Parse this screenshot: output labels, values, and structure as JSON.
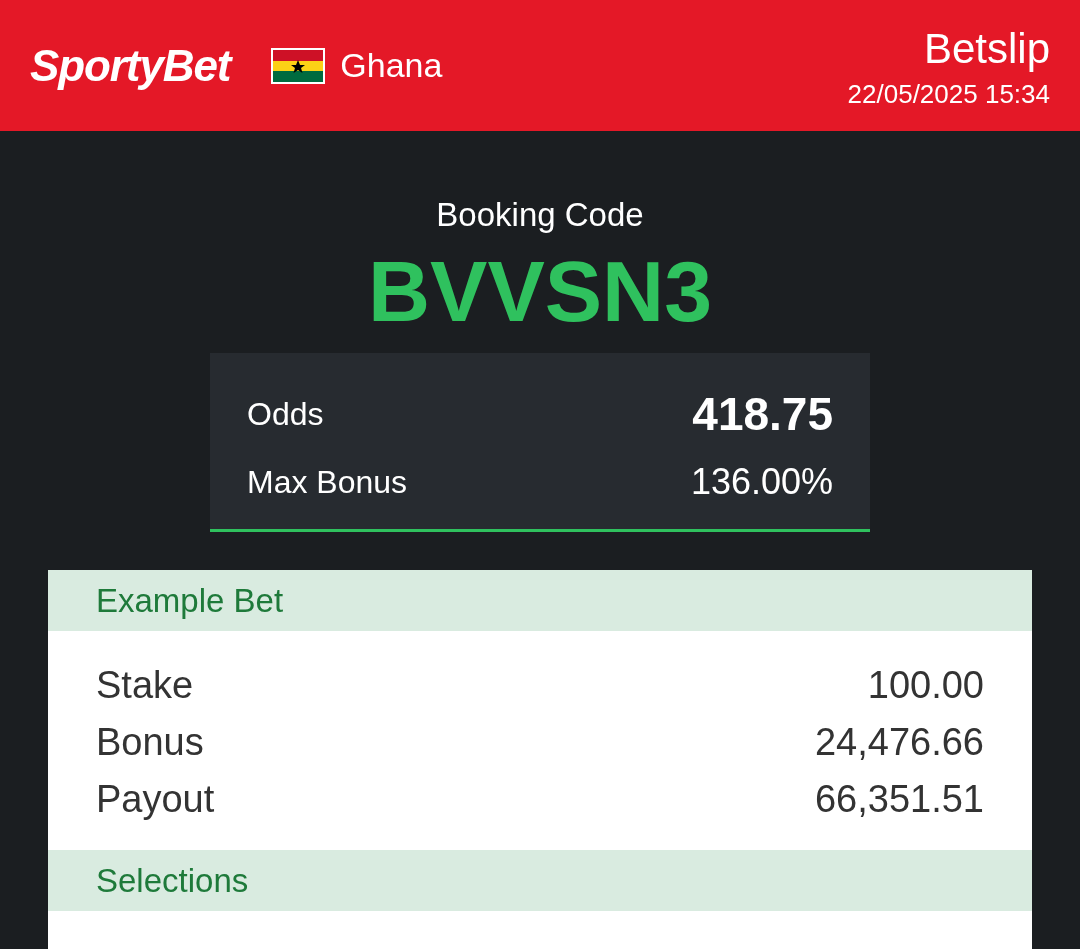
{
  "header": {
    "logo": "SportyBet",
    "country": "Ghana",
    "title": "Betslip",
    "datetime": "22/05/2025 15:34"
  },
  "booking": {
    "label": "Booking Code",
    "code": "BVVSN3"
  },
  "summary": [
    {
      "label": "Odds",
      "value": "418.75",
      "kind": "odds"
    },
    {
      "label": "Max Bonus",
      "value": "136.00%",
      "kind": "bonus"
    }
  ],
  "example_bet": {
    "title": "Example Bet",
    "rows": [
      {
        "label": "Stake",
        "value": "100.00"
      },
      {
        "label": "Bonus",
        "value": "24,476.66"
      },
      {
        "label": "Payout",
        "value": "66,351.51"
      }
    ]
  },
  "selections": {
    "title": "Selections"
  }
}
